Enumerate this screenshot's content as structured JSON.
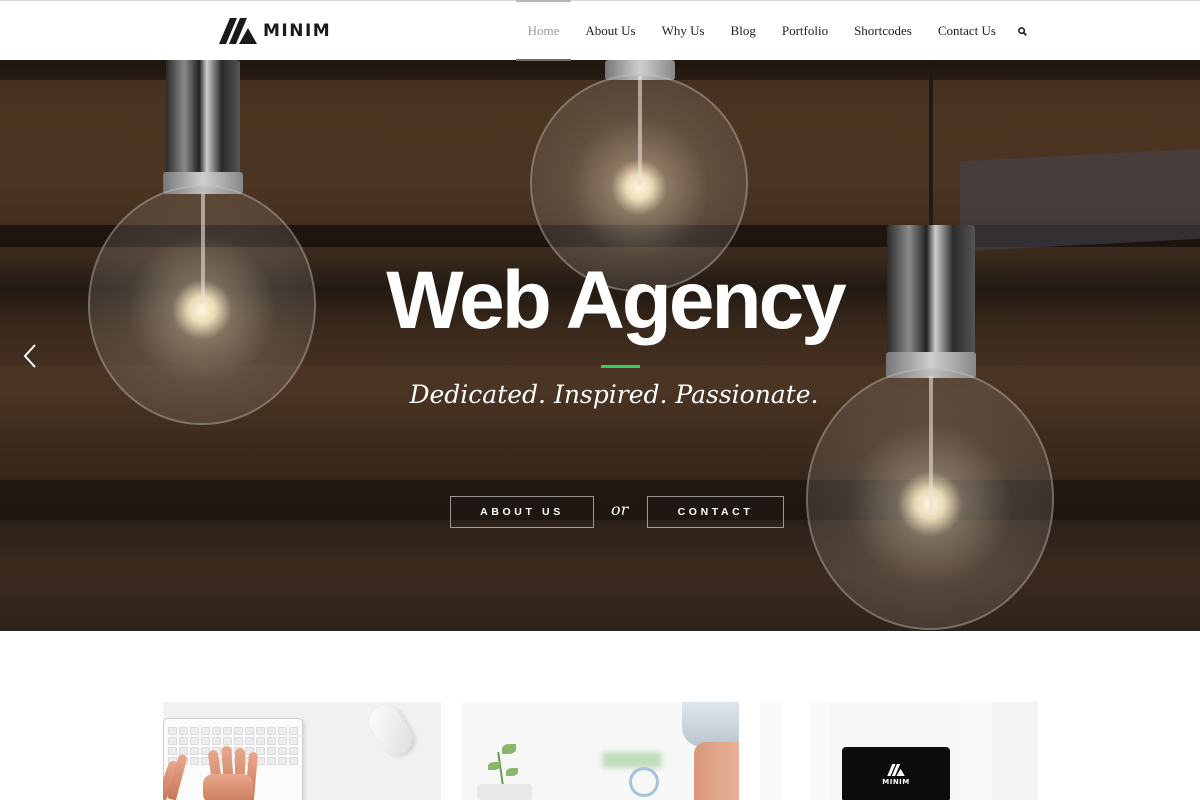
{
  "header": {
    "logo_text": "MINIM",
    "nav": [
      {
        "label": "Home",
        "active": true
      },
      {
        "label": "About Us",
        "active": false
      },
      {
        "label": "Why Us",
        "active": false
      },
      {
        "label": "Blog",
        "active": false
      },
      {
        "label": "Portfolio",
        "active": false
      },
      {
        "label": "Shortcodes",
        "active": false
      },
      {
        "label": "Contact Us",
        "active": false
      }
    ],
    "search_icon": "search-icon"
  },
  "hero": {
    "title": "Web Agency",
    "subtitle": "Dedicated. Inspired. Passionate.",
    "divider_color": "#2fcf59",
    "buttons": {
      "about": "ABOUT US",
      "or": "or",
      "contact": "CONTACT"
    },
    "prev_icon": "chevron-left-icon"
  },
  "cards": [
    {
      "image": "keyboard-typing-photo"
    },
    {
      "image": "desk-plant-photo"
    },
    {
      "image": "tablet-logo-photo",
      "tablet_text": "MINIM"
    }
  ]
}
